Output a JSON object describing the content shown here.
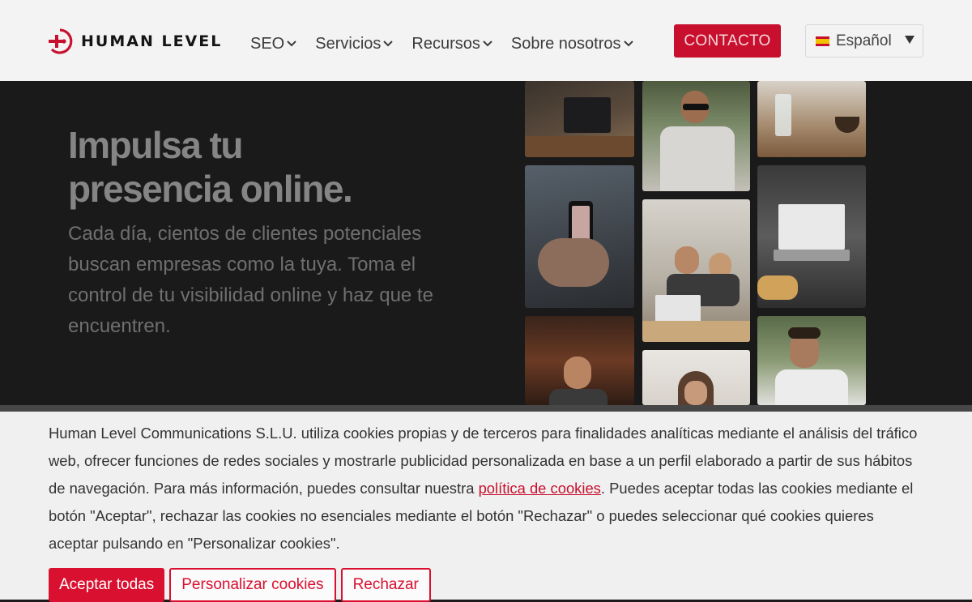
{
  "header": {
    "logo_text": "HUMAN LEVEL",
    "nav": [
      {
        "label": "SEO"
      },
      {
        "label": "Servicios"
      },
      {
        "label": "Recursos"
      },
      {
        "label": "Sobre nosotros"
      }
    ],
    "contact_label": "CONTACTO",
    "language_label": "Español"
  },
  "hero": {
    "title_line1": "Impulsa tu",
    "title_line2": "presencia online.",
    "description": "Cada día, cientos de clientes potenciales buscan empresas como la tuya. Toma el control de tu visibilidad online y haz que te encuentren."
  },
  "cookie_banner": {
    "text_before_link": "Human Level Communications S.L.U. utiliza cookies propias y de terceros para finalidades analíticas mediante el análisis del tráfico web, ofrecer funciones de redes sociales y mostrarle publicidad personalizada en base a un perfil elaborado a partir de sus hábitos de navegación. Para más información, puedes consultar nuestra ",
    "link_text": "política de cookies",
    "text_after_link": ". Puedes aceptar todas las cookies mediante el botón \"Aceptar\", rechazar las cookies no esenciales mediante el botón \"Rechazar\" o puedes seleccionar qué cookies quieres aceptar pulsando en \"Personalizar cookies\".",
    "accept_label": "Aceptar todas",
    "customize_label": "Personalizar cookies",
    "reject_label": "Rechazar"
  },
  "colors": {
    "brand_red": "#c8102e",
    "hero_background": "#1a1a1a",
    "banner_background": "#f0f0f0"
  }
}
